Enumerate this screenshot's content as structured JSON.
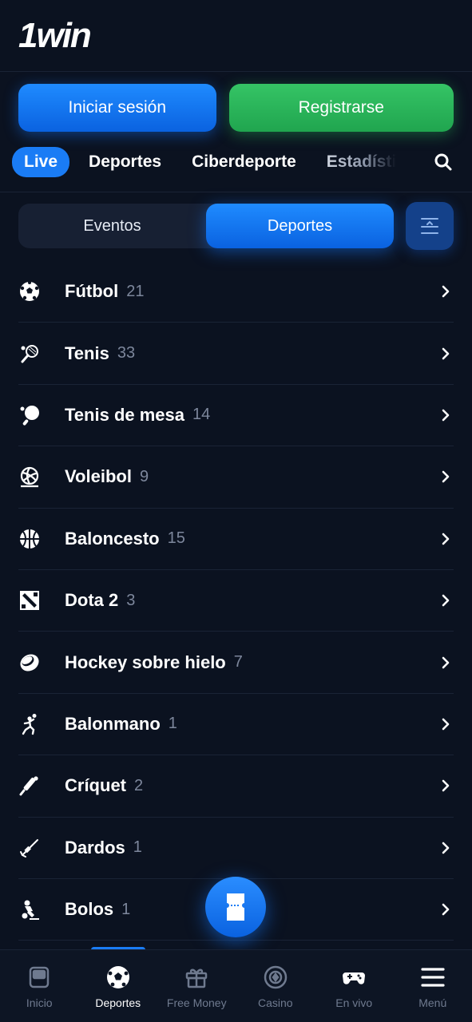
{
  "header": {
    "logo": "1win"
  },
  "auth": {
    "login_label": "Iniciar sesión",
    "register_label": "Registrarse"
  },
  "tabs": [
    {
      "label": "Live"
    },
    {
      "label": "Deportes"
    },
    {
      "label": "Ciberdeporte"
    },
    {
      "label": "Estadísti"
    }
  ],
  "segment": {
    "events_label": "Eventos",
    "sports_label": "Deportes",
    "active": "Deportes"
  },
  "sports": [
    {
      "name": "Fútbol",
      "count": "21",
      "icon": "soccer-ball-icon"
    },
    {
      "name": "Tenis",
      "count": "33",
      "icon": "tennis-racket-icon"
    },
    {
      "name": "Tenis de mesa",
      "count": "14",
      "icon": "ping-pong-icon"
    },
    {
      "name": "Voleibol",
      "count": "9",
      "icon": "volleyball-icon"
    },
    {
      "name": "Baloncesto",
      "count": "15",
      "icon": "basketball-icon"
    },
    {
      "name": "Dota 2",
      "count": "3",
      "icon": "dota-icon"
    },
    {
      "name": "Hockey sobre hielo",
      "count": "7",
      "icon": "hockey-puck-icon"
    },
    {
      "name": "Balonmano",
      "count": "1",
      "icon": "handball-icon"
    },
    {
      "name": "Críquet",
      "count": "2",
      "icon": "cricket-icon"
    },
    {
      "name": "Dardos",
      "count": "1",
      "icon": "darts-icon"
    },
    {
      "name": "Bolos",
      "count": "1",
      "icon": "bowling-icon"
    }
  ],
  "bottom_nav": [
    {
      "label": "Inicio",
      "icon": "home-icon"
    },
    {
      "label": "Deportes",
      "icon": "soccer-ball-icon",
      "active": true
    },
    {
      "label": "Free Money",
      "icon": "gift-icon"
    },
    {
      "label": "Casino",
      "icon": "casino-chip-icon"
    },
    {
      "label": "En vivo",
      "icon": "gamepad-icon"
    },
    {
      "label": "Menú",
      "icon": "menu-icon"
    }
  ],
  "colors": {
    "background": "#0b1220",
    "accent": "#1a7cf5",
    "register": "#2bb55a",
    "muted": "#7d879c"
  }
}
